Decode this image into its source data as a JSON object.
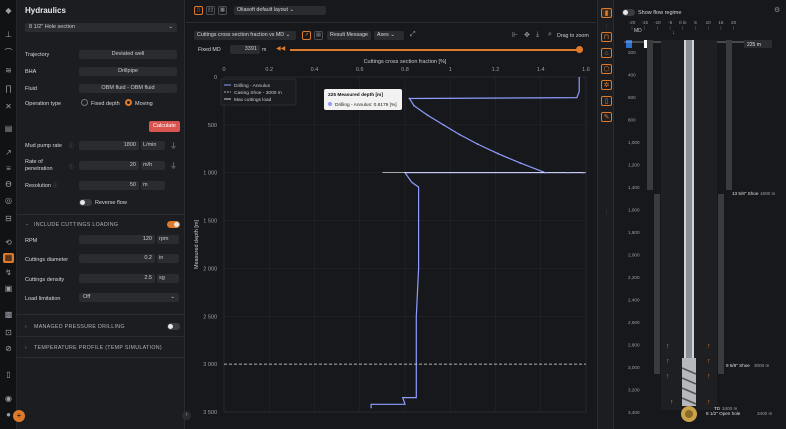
{
  "panel": {
    "title": "Hydraulics",
    "section_select": "8 1/2\" Hole section",
    "trajectory": {
      "label": "Trajectory",
      "value": "Deviated well"
    },
    "bha": {
      "label": "BHA",
      "value": "Drillpipe"
    },
    "fluid": {
      "label": "Fluid",
      "value": "OBM fluid - OBM fluid"
    },
    "operation": {
      "label": "Operation type",
      "opt1": "Fixed depth",
      "opt2": "Moving"
    },
    "calculate": "Calculate",
    "mud_rate": {
      "label": "Mud pump rate",
      "value": "1800",
      "unit": "L/min"
    },
    "rop": {
      "label1": "Rate of",
      "label2": "penetration",
      "value": "20",
      "unit": "m/h"
    },
    "resolution": {
      "label": "Resolution",
      "value": "50",
      "unit": "m"
    },
    "reverse_flow": "Reverse flow",
    "cuttings_section": "INCLUDE CUTTINGS LOADING",
    "rpm": {
      "label": "RPM",
      "value": "120",
      "unit": "rpm"
    },
    "cuttings_diameter": {
      "label": "Cuttings diameter",
      "value": "0.2",
      "unit": "in"
    },
    "cuttings_density": {
      "label": "Cuttings density",
      "value": "2.5",
      "unit": "sg"
    },
    "load_limitation": {
      "label": "Load limitation",
      "value": "Off"
    },
    "mpd_section": "MANAGED PRESSURE DRILLING",
    "temp_section": "TEMPERATURE PROFILE (TEMP SIMULATION)"
  },
  "toolbar": {
    "layout": "Oliasoft default layout",
    "chart_select": "Cuttings cross section fraction vs MD",
    "result_message": "Result Message",
    "axes": "Axes",
    "drag_zoom": "Drag to zoom",
    "fixed_md_label": "Fixed MD",
    "fixed_md_value": "3391",
    "fixed_md_unit": "m"
  },
  "tooltip": {
    "title": "225 Measured depth [m]",
    "series": "Drilling - Annulus: 0.8179 [%]"
  },
  "colors": {
    "accent": "#e07a2b",
    "series": "#8f9cff",
    "casing": "#e0e0e0",
    "max": "#ffffff"
  },
  "chart_data": {
    "type": "line",
    "title": "",
    "xlabel": "Cuttings cross section fraction [%]",
    "ylabel": "Measured depth [m]",
    "xlim": [
      0,
      1.6
    ],
    "ylim": [
      3500,
      0
    ],
    "xticks": [
      "0",
      "0.2",
      "0.4",
      "0.6",
      "0.8",
      "1",
      "1.2",
      "1.4",
      "1.6"
    ],
    "yticks": [
      "0",
      "500",
      "1 000",
      "1 500",
      "2 000",
      "2 500",
      "3 000",
      "3 500"
    ],
    "legend": [
      "Drilling - Annulus",
      "Casing Shoe - 3000 m",
      "Max cuttings load"
    ],
    "series": [
      {
        "name": "Drilling - Annulus",
        "x": [
          1.57,
          1.57,
          1.56,
          0.82,
          0.84,
          0.9,
          0.97,
          1.04,
          1.12,
          1.21,
          1.31,
          1.42,
          1.52,
          1.59,
          0.8,
          0.83,
          0.86,
          0.86,
          0.85,
          0.85,
          0.85,
          0.79,
          0.8,
          0.65,
          0.65
        ],
        "y": [
          0,
          150,
          215,
          225,
          300,
          400,
          500,
          600,
          700,
          800,
          900,
          1000,
          1000,
          1000,
          1000,
          1100,
          1150,
          2000,
          2500,
          2920,
          3350,
          3350,
          3420,
          3420,
          3460
        ]
      },
      {
        "name": "Casing Shoe - 3000 m",
        "x": [
          0,
          1.6
        ],
        "y": [
          3000,
          3000
        ]
      },
      {
        "name": "Max cuttings load",
        "x": [
          0.7,
          1.6
        ],
        "y": [
          1000,
          1000
        ]
      }
    ]
  },
  "wellbore": {
    "flow_regime": "Show flow regime",
    "top_ticks": [
      "-20",
      "-15",
      "-10",
      "-5",
      "0 in",
      "5",
      "10",
      "15",
      "20"
    ],
    "md_label": "MD",
    "md_marker": "225 m",
    "depth_ticks": [
      "200",
      "400",
      "600",
      "800",
      "1,000",
      "1,200",
      "1,400",
      "1,600",
      "1,800",
      "2,000",
      "2,200",
      "2,400",
      "2,600",
      "2,800",
      "3,000",
      "3,200",
      "3,400"
    ],
    "shoe1": "13 5/8\" Shoe",
    "shoe1_depth": "1600 m",
    "shoe2": "9 5/8\" Shoe",
    "shoe2_depth": "3000 m",
    "td": "TD",
    "td_depth": "3400 m",
    "open_hole": "8 1/2\" Open hole",
    "open_hole_depth": "3400 m"
  }
}
